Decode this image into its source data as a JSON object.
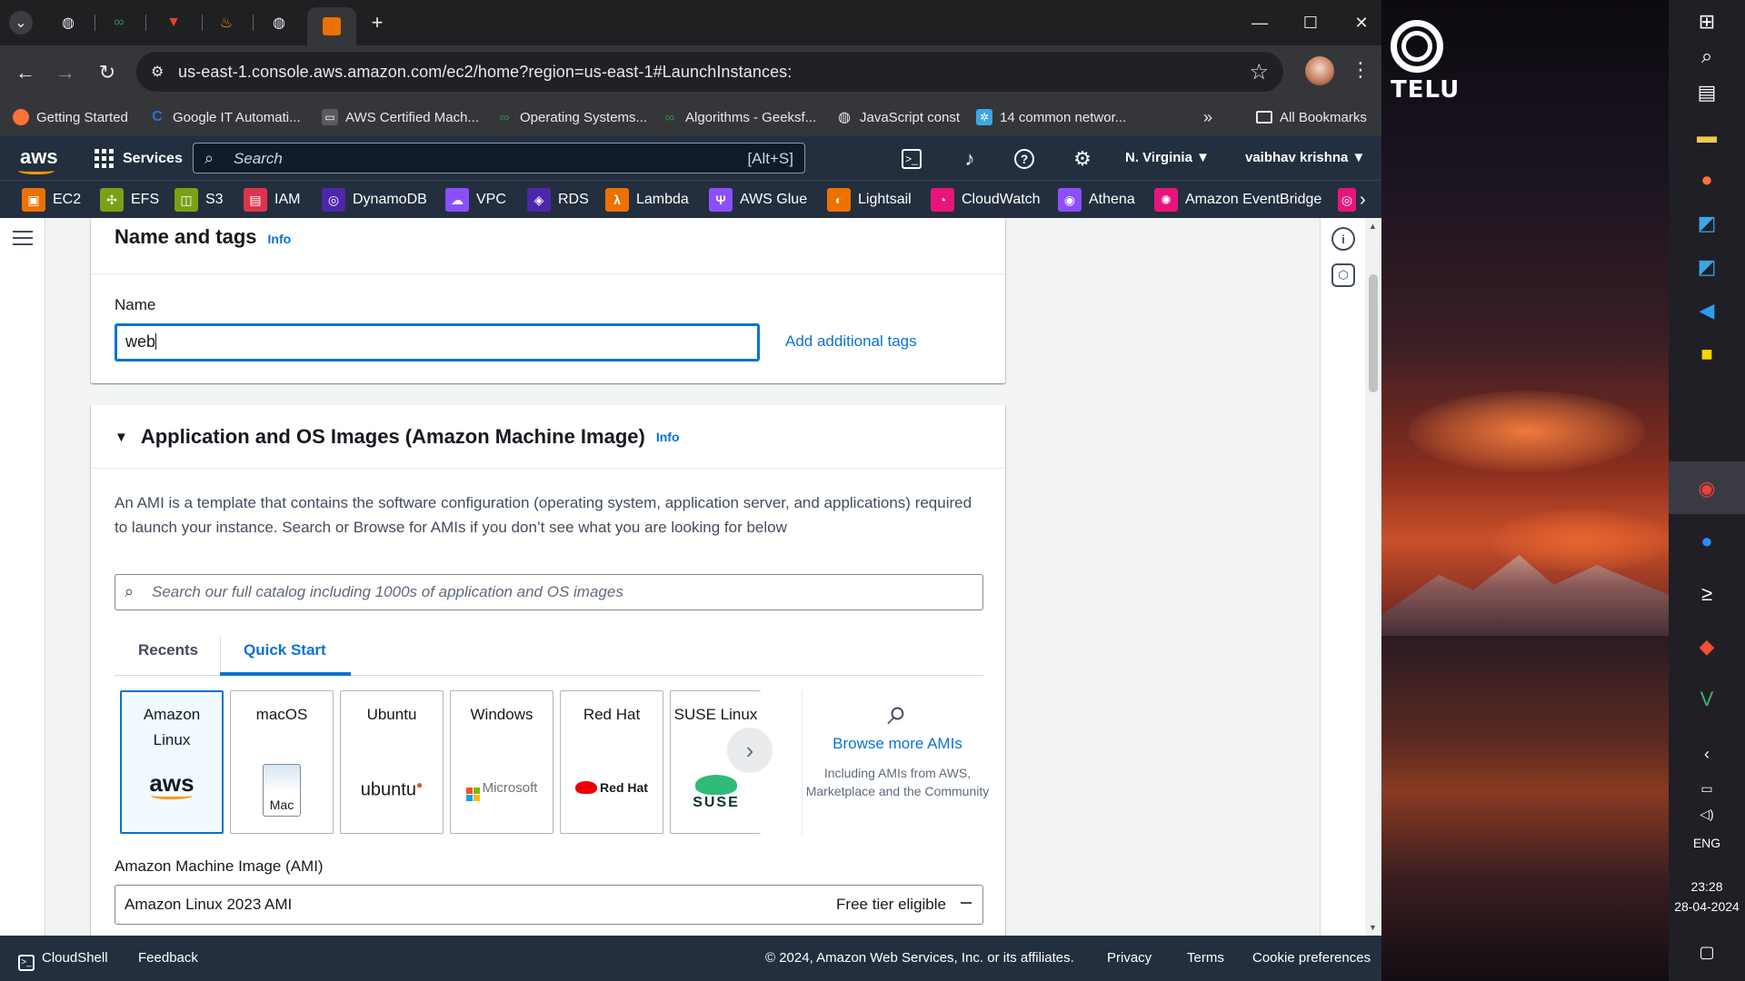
{
  "browser": {
    "address": "us-east-1.console.aws.amazon.com/ec2/home?region=us-east-1#LaunchInstances:",
    "bookmarks": [
      {
        "label": "Getting Started",
        "icon": "firefox-icon",
        "color": "#ff7139"
      },
      {
        "label": "Google IT Automati...",
        "icon": "coursera-icon",
        "color": "#2a73cc"
      },
      {
        "label": "AWS Certified Mach...",
        "icon": "udemy-icon",
        "color": "#a435f0"
      },
      {
        "label": "Operating Systems...",
        "icon": "geeksforgeeks-icon",
        "color": "#2f8d46"
      },
      {
        "label": "Algorithms - Geeksf...",
        "icon": "geeksforgeeks-icon",
        "color": "#2f8d46"
      },
      {
        "label": "JavaScript const",
        "icon": "globe-icon",
        "color": "#e8eaed"
      },
      {
        "label": "14 common networ...",
        "icon": "network-icon",
        "color": "#3ba7e5"
      }
    ],
    "all_bookmarks": "All Bookmarks"
  },
  "aws": {
    "logo": "aws",
    "services": "Services",
    "search_placeholder": "Search",
    "search_hotkey": "[Alt+S]",
    "region": "N. Virginia ▼",
    "user": "vaibhav krishna ▼",
    "favorites": [
      {
        "label": "EC2",
        "color": "#ed7100"
      },
      {
        "label": "EFS",
        "color": "#7aa116"
      },
      {
        "label": "S3",
        "color": "#7aa116"
      },
      {
        "label": "IAM",
        "color": "#dd344c"
      },
      {
        "label": "DynamoDB",
        "color": "#4d27aa"
      },
      {
        "label": "VPC",
        "color": "#8c4fff"
      },
      {
        "label": "RDS",
        "color": "#4d27aa"
      },
      {
        "label": "Lambda",
        "color": "#ed7100"
      },
      {
        "label": "AWS Glue",
        "color": "#8c4fff"
      },
      {
        "label": "Lightsail",
        "color": "#ed7100"
      },
      {
        "label": "CloudWatch",
        "color": "#e7157b"
      },
      {
        "label": "Athena",
        "color": "#8c4fff"
      },
      {
        "label": "Amazon EventBridge",
        "color": "#e7157b"
      }
    ]
  },
  "name_tags": {
    "title": "Name and tags",
    "info": "Info",
    "name_label": "Name",
    "name_value": "web",
    "add_tags": "Add additional tags"
  },
  "ami": {
    "title": "Application and OS Images (Amazon Machine Image)",
    "info": "Info",
    "description": "An AMI is a template that contains the software configuration (operating system, application server, and applications) required to launch your instance. Search or Browse for AMIs if you don’t see what you are looking for below",
    "search_placeholder": "Search our full catalog including 1000s of application and OS images",
    "tabs": [
      "Recents",
      "Quick Start"
    ],
    "tiles": [
      {
        "name": "Amazon Linux",
        "logo": "aws"
      },
      {
        "name": "macOS",
        "logo": "Mac"
      },
      {
        "name": "Ubuntu",
        "logo": "ubuntu"
      },
      {
        "name": "Windows",
        "logo": "Microsoft"
      },
      {
        "name": "Red Hat",
        "logo": "Red Hat"
      },
      {
        "name": "SUSE Linux",
        "logo": "SUSE"
      }
    ],
    "browse_title": "Browse more AMIs",
    "browse_sub": "Including AMIs from AWS, Marketplace and the Community",
    "ami_label": "Amazon Machine Image (AMI)",
    "ami_value": "Amazon Linux 2023 AMI",
    "ami_badge": "Free tier eligible"
  },
  "footer": {
    "cloudshell": "CloudShell",
    "feedback": "Feedback",
    "copyright": "© 2024, Amazon Web Services, Inc. or its affiliates.",
    "privacy": "Privacy",
    "terms": "Terms",
    "cookies": "Cookie preferences"
  },
  "desktop": {
    "logo_text": "TELU",
    "language": "ENG",
    "time": "23:28",
    "date": "28-04-2024"
  }
}
